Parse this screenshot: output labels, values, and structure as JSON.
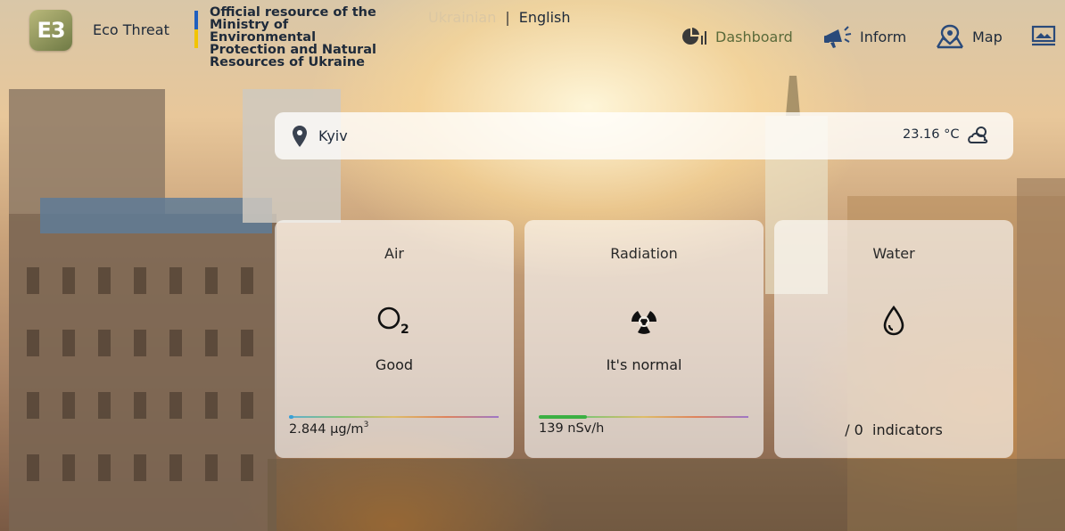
{
  "header": {
    "logo_text": "E3",
    "brand": "Eco Threat",
    "official_lines": [
      "Official resource of the",
      "Ministry of",
      "Environmental",
      "Protection and Natural",
      "Resources of Ukraine"
    ],
    "lang_ua": "Ukrainian",
    "lang_sep": "|",
    "lang_en": "English"
  },
  "nav": {
    "dashboard": "Dashboard",
    "inform": "Inform",
    "map": "Map"
  },
  "location": {
    "city": "Kyiv",
    "temperature": "23.16 °C"
  },
  "cards": {
    "air": {
      "title": "Air",
      "status": "Good",
      "value": "2.844 μg/m",
      "value_sup": "3",
      "level": 0.02
    },
    "radiation": {
      "title": "Radiation",
      "status": "It's normal",
      "value": "139 nSv/h",
      "level": 0.23
    },
    "water": {
      "title": "Water",
      "count": "/ 0",
      "count_label": "indicators"
    }
  },
  "colors": {
    "accent_nav": "#5a6a3a",
    "text": "#1e2a3a",
    "flag_blue": "#1f5fbf",
    "flag_yellow": "#f2c400"
  }
}
